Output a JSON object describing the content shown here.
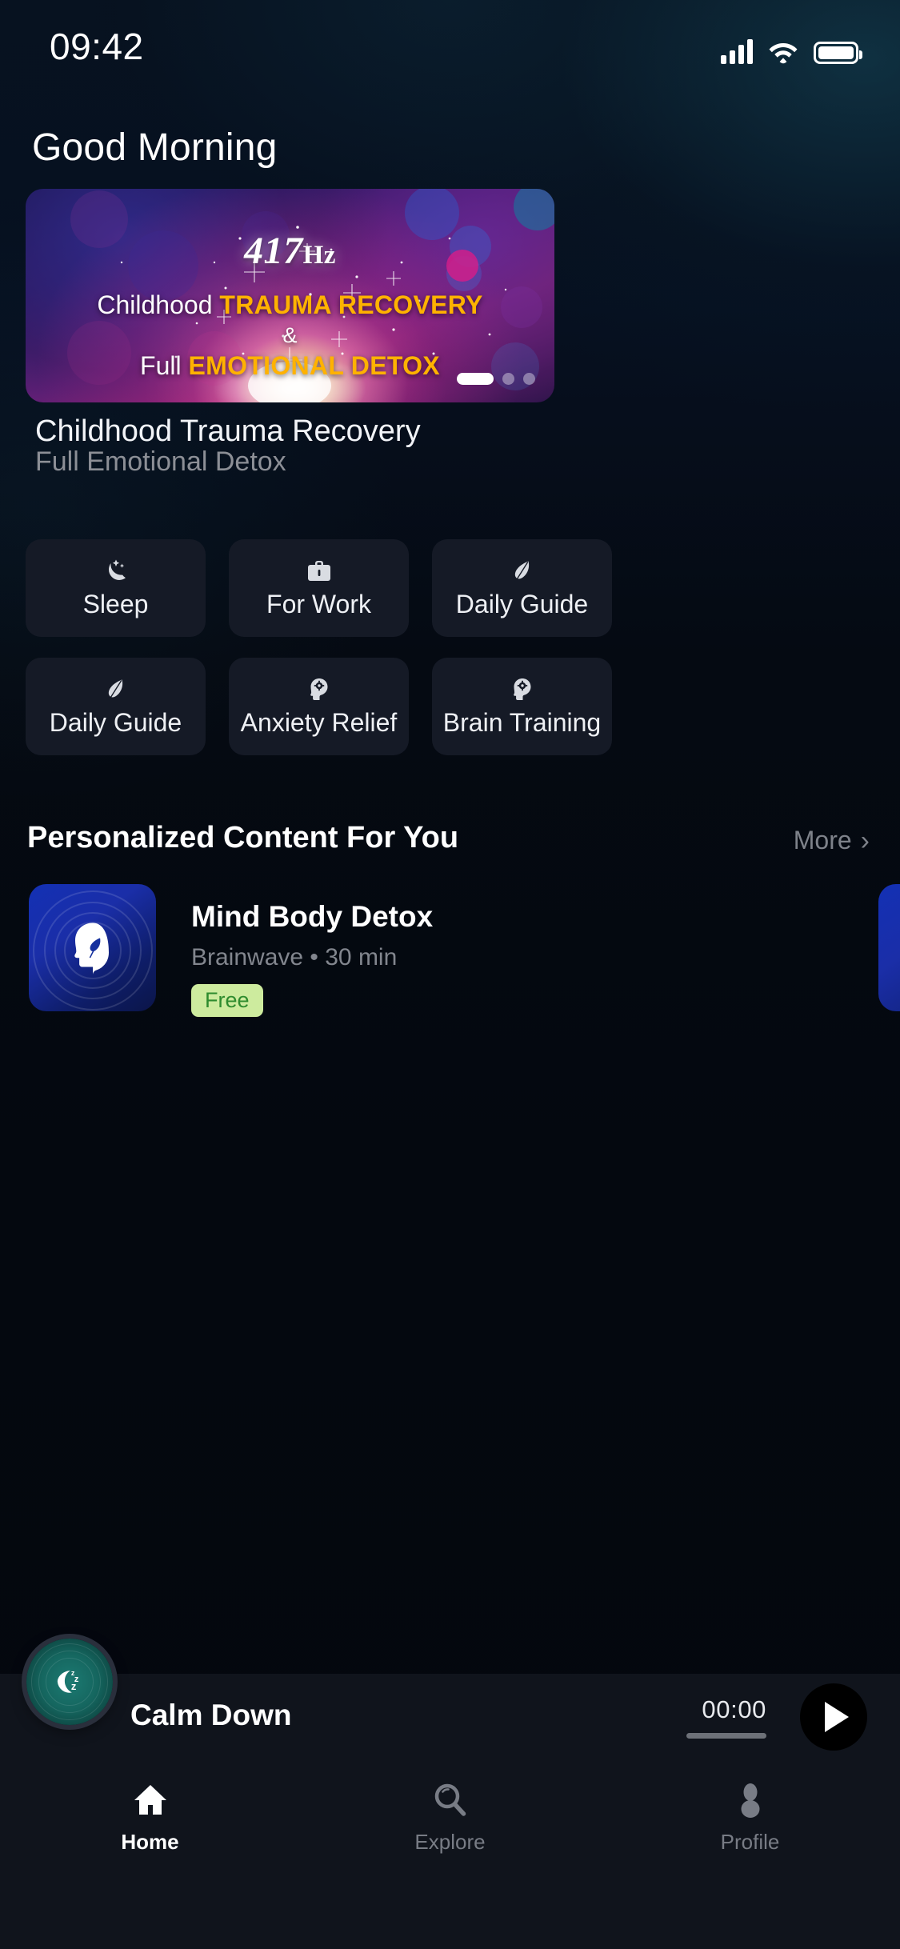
{
  "status_bar": {
    "time": "09:42",
    "signal_icon": "cellular-signal-icon",
    "wifi_icon": "wifi-icon",
    "battery_icon": "battery-full-icon"
  },
  "header": {
    "greeting": "Good Morning"
  },
  "hero": {
    "frequency": "417",
    "frequency_unit": "Hz",
    "line1_plain": "Childhood ",
    "line1_highlight": "TRAUMA RECOVERY",
    "line2": "&",
    "line3_plain": "Full ",
    "line3_highlight": "EMOTIONAL DETOX",
    "title": "Childhood Trauma Recovery",
    "subtitle": "Full Emotional Detox",
    "highlight_color": "#FFB200",
    "pagination": {
      "total": 3,
      "active_index": 0
    }
  },
  "categories": [
    {
      "label": "Sleep",
      "icon": "moon-stars-icon"
    },
    {
      "label": "For Work",
      "icon": "briefcase-icon"
    },
    {
      "label": "Daily Guide",
      "icon": "leaf-icon"
    },
    {
      "label": "Daily Guide",
      "icon": "leaf-icon"
    },
    {
      "label": "Anxiety Relief",
      "icon": "head-gear-icon"
    },
    {
      "label": "Brain Training",
      "icon": "head-gear-icon"
    }
  ],
  "personalized": {
    "section_title": "Personalized Content For You",
    "more_label": "More",
    "more_chevron": "›",
    "items": [
      {
        "title": "Mind Body Detox",
        "meta": "Brainwave • 30 min",
        "badge": "Free",
        "badge_bg": "#CDEB9E",
        "badge_color": "#2E8B2E",
        "artwork_icon": "head-leaf-icon"
      }
    ]
  },
  "mini_player": {
    "track_title": "Calm Down",
    "elapsed": "00:00",
    "artwork_icon": "moon-zzz-icon",
    "play_icon": "play-icon"
  },
  "bottom_nav": {
    "items": [
      {
        "label": "Home",
        "icon": "home-icon",
        "active": true
      },
      {
        "label": "Explore",
        "icon": "search-icon",
        "active": false
      },
      {
        "label": "Profile",
        "icon": "person-icon",
        "active": false
      }
    ]
  }
}
